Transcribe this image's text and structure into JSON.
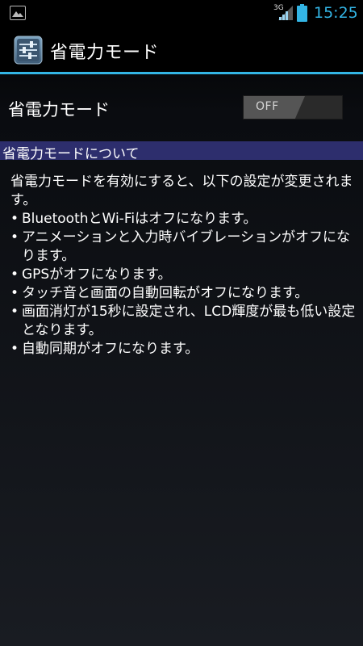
{
  "status_bar": {
    "network_type": "3G",
    "time": "15:25",
    "notification_icon": "image-icon",
    "signal_icon": "signal-icon",
    "battery_icon": "battery-icon"
  },
  "action_bar": {
    "title": "省電力モード",
    "icon": "settings-sliders-icon"
  },
  "toggle": {
    "label": "省電力モード",
    "state_label": "OFF"
  },
  "section": {
    "title": "省電力モードについて"
  },
  "description": {
    "intro": "省電力モードを有効にすると、以下の設定が変更されます。",
    "items": [
      "BluetoothとWi-Fiはオフになります。",
      "アニメーションと入力時バイブレーションがオフになります。",
      "GPSがオフになります。",
      "タッチ音と画面の自動回転がオフになります。",
      "画面消灯が15秒に設定され、LCD輝度が最も低い設定となります。",
      "自動同期がオフになります。"
    ],
    "bullet": "•"
  },
  "colors": {
    "accent": "#33b5e5",
    "section_bg": "#2d2e6d"
  }
}
